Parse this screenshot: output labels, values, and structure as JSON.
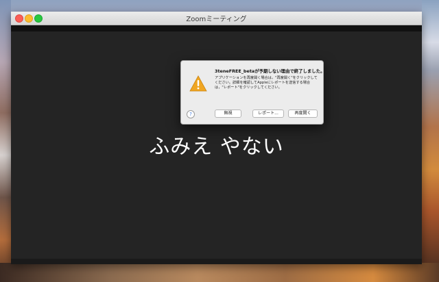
{
  "window": {
    "title": "Zoomミーティング"
  },
  "meeting": {
    "participant_name": "ふみえ やない"
  },
  "dialog": {
    "title": "3teneFREE_betaが予期しない理由で終了しました。",
    "message": "アプリケーションを再度開く場合は，\"再度開く\"をクリックしてください。詳細を確認してAppleにレポートを送信する場合は，\"レポート\"をクリックしてください。",
    "help_label": "?",
    "buttons": {
      "ignore": "無視",
      "report": "レポート...",
      "reopen": "再度開く"
    },
    "icon": "warning-triangle-icon"
  },
  "colors": {
    "close": "#fc5f57",
    "minimize": "#fdbc2e",
    "maximize": "#28c840",
    "video_bg": "#242424",
    "warning": "#f0a622"
  }
}
